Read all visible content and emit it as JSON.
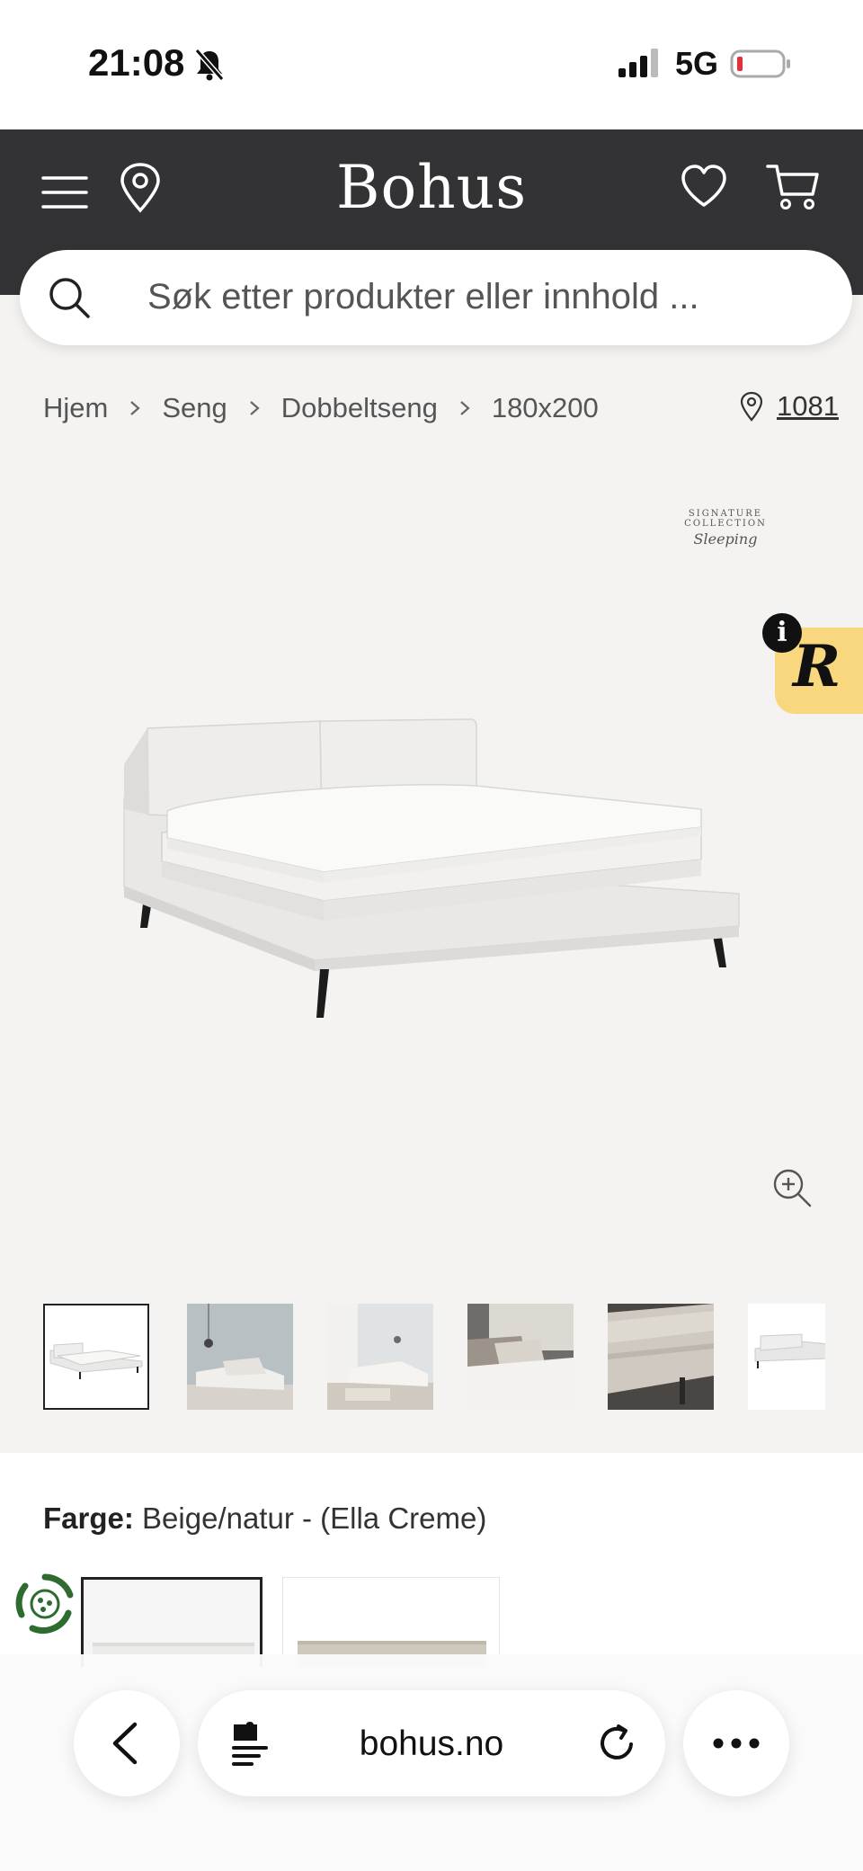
{
  "status_bar": {
    "time": "21:08",
    "network": "5G",
    "icons": [
      "bell-slash-icon",
      "signal-icon",
      "battery-low-icon"
    ]
  },
  "header": {
    "logo": "Bohus",
    "icons": [
      "menu-icon",
      "location-pin-icon",
      "heart-icon",
      "cart-icon"
    ],
    "background": "#333336"
  },
  "search": {
    "placeholder": "Søk etter produkter eller innhold ..."
  },
  "breadcrumb": {
    "items": [
      "Hjem",
      "Seng",
      "Dobbeltseng",
      "180x200"
    ],
    "store_code": "1081"
  },
  "product_image": {
    "brand_badge_script": "Sleeping",
    "brand_badge_title": "SIGNATURE COLLECTION",
    "floating_badge": "R",
    "info_badge": "i",
    "badge_color": "#f9d77e"
  },
  "thumbnails": {
    "count": 6,
    "selected_index": 0
  },
  "product_info": {
    "color_label": "Farge:",
    "color_value": "Beige/natur - (Ella Creme)"
  },
  "browser": {
    "url": "bohus.no",
    "icons": [
      "back-chevron-icon",
      "extension-icon",
      "reload-icon",
      "more-icon"
    ]
  }
}
